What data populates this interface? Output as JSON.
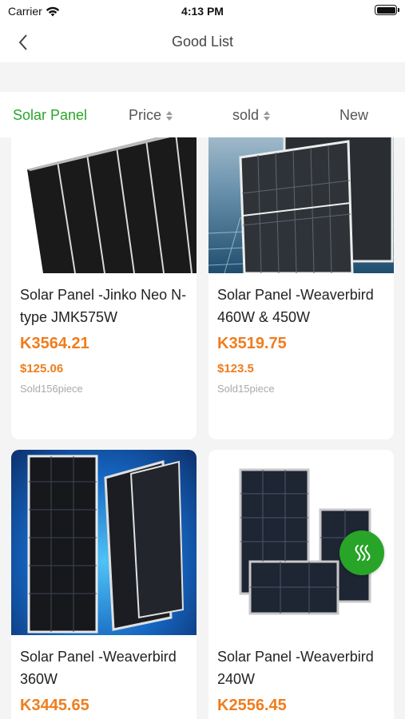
{
  "status_bar": {
    "carrier": "Carrier",
    "time": "4:13 PM"
  },
  "header": {
    "title": "Good List"
  },
  "filters": [
    {
      "label": "Solar Panel",
      "active": true
    },
    {
      "label": "Price",
      "sortable": true
    },
    {
      "label": "sold",
      "sortable": true
    },
    {
      "label": "New"
    }
  ],
  "products": [
    {
      "name": "Solar Panel -Jinko Neo N-type JMK575W",
      "price": "K3564.21",
      "usd_price": "$125.06",
      "sold": "Sold156piece"
    },
    {
      "name": "Solar Panel -Weaverbird 460W & 450W",
      "price": "K3519.75",
      "usd_price": "$123.5",
      "sold": "Sold15piece"
    },
    {
      "name": "Solar Panel -Weaverbird 360W",
      "price": "K3445.65"
    },
    {
      "name": "Solar Panel -Weaverbird 240W",
      "price": "K2556.45"
    }
  ],
  "colors": {
    "accent": "#2aa52a",
    "price": "#ef7d1e",
    "badge": "#28a428"
  },
  "icons": {
    "back": "chevron-left-icon",
    "badge": "waves-icon"
  }
}
